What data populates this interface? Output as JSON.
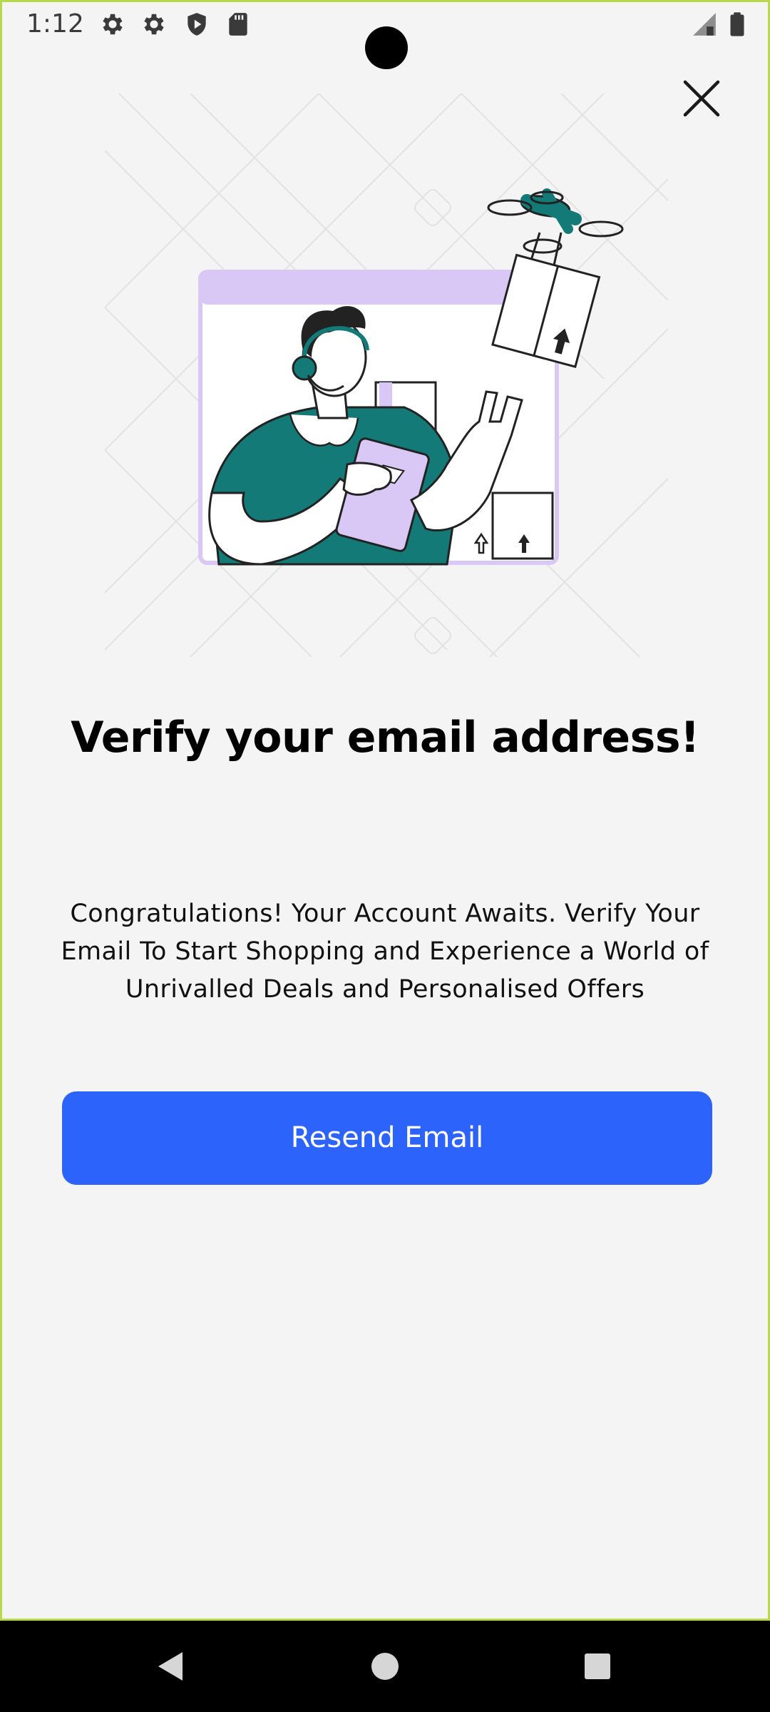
{
  "status_bar": {
    "time": "1:12",
    "icons": [
      "settings-gear-icon",
      "settings-gear-icon",
      "shield-play-icon",
      "sd-card-icon",
      "signal-icon",
      "battery-icon"
    ]
  },
  "dialog": {
    "close_icon": "close-icon",
    "illustration": "delivery-support-illustration",
    "title": "Verify your email address!",
    "description": "Congratulations! Your Account Awaits. Verify Your Email To Start Shopping and Experience a World of Unrivalled Deals and Personalised Offers",
    "resend_button_label": "Resend Email"
  },
  "nav_bar": {
    "icons": [
      "back-icon",
      "home-icon",
      "recents-icon"
    ]
  },
  "colors": {
    "background": "#f4f4f4",
    "primary_button": "#2c64fb",
    "accent_teal": "#147a78",
    "accent_lavender": "#d9c8f5"
  }
}
